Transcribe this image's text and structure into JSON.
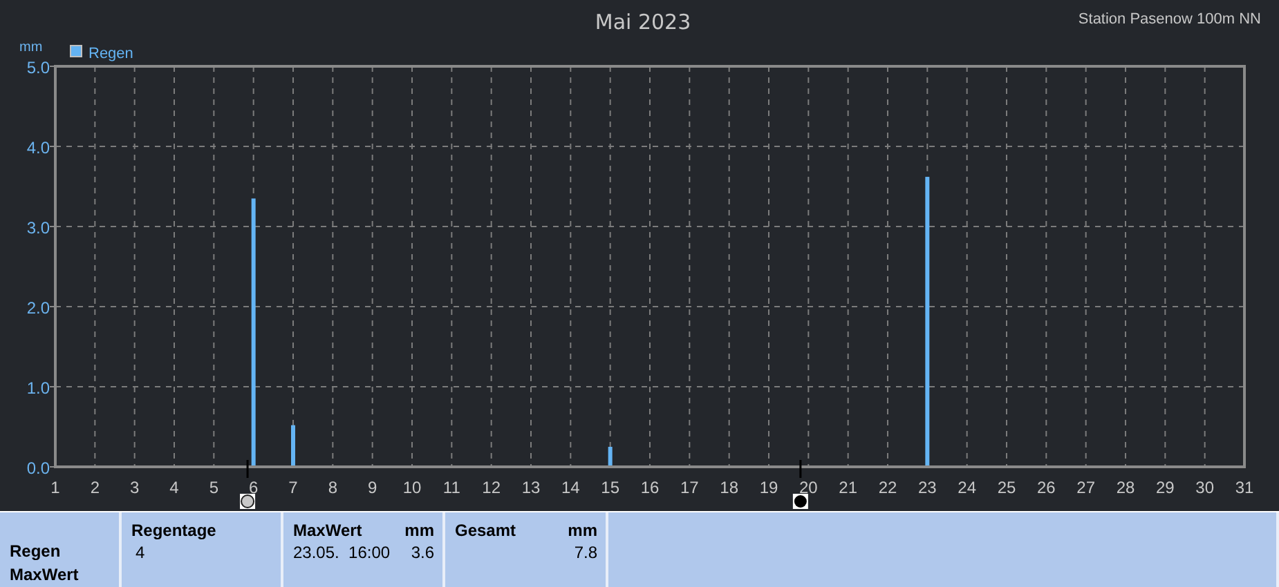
{
  "header": {
    "title": "Mai 2023",
    "station": "Station Pasenow 100m NN"
  },
  "chart": {
    "chart_data": {
      "type": "bar",
      "ylabel": "mm",
      "x": [
        6,
        7,
        15,
        23
      ],
      "series": [
        {
          "name": "Regen",
          "color": "#64b4f4",
          "values": [
            3.35,
            0.52,
            0.25,
            3.62
          ]
        }
      ],
      "xlim": [
        1,
        31
      ],
      "ylim": [
        0,
        5
      ],
      "xticks": [
        1,
        2,
        3,
        4,
        5,
        6,
        7,
        8,
        9,
        10,
        11,
        12,
        13,
        14,
        15,
        16,
        17,
        18,
        19,
        20,
        21,
        22,
        23,
        24,
        25,
        26,
        27,
        28,
        29,
        30,
        31
      ],
      "yticks": [
        {
          "value": 0,
          "label": "0.0"
        },
        {
          "value": 1,
          "label": "1.0"
        },
        {
          "value": 2,
          "label": "2.0"
        },
        {
          "value": 3,
          "label": "3.0"
        },
        {
          "value": 4,
          "label": "4.0"
        },
        {
          "value": 5,
          "label": "5.0"
        }
      ],
      "grid": true
    },
    "moon_phases": [
      {
        "kind": "full-moon"
      },
      {
        "kind": "new-moon"
      }
    ]
  },
  "summary": {
    "row_labels": [
      "Regen",
      "MaxWert"
    ],
    "columns": [
      {
        "title": "Regentage",
        "value": "4"
      },
      {
        "title": "MaxWert",
        "unit": "mm",
        "label": "23.05.  16:00",
        "value": "3.6"
      },
      {
        "title": "Gesamt",
        "unit": "mm",
        "value": "7.8"
      }
    ]
  }
}
